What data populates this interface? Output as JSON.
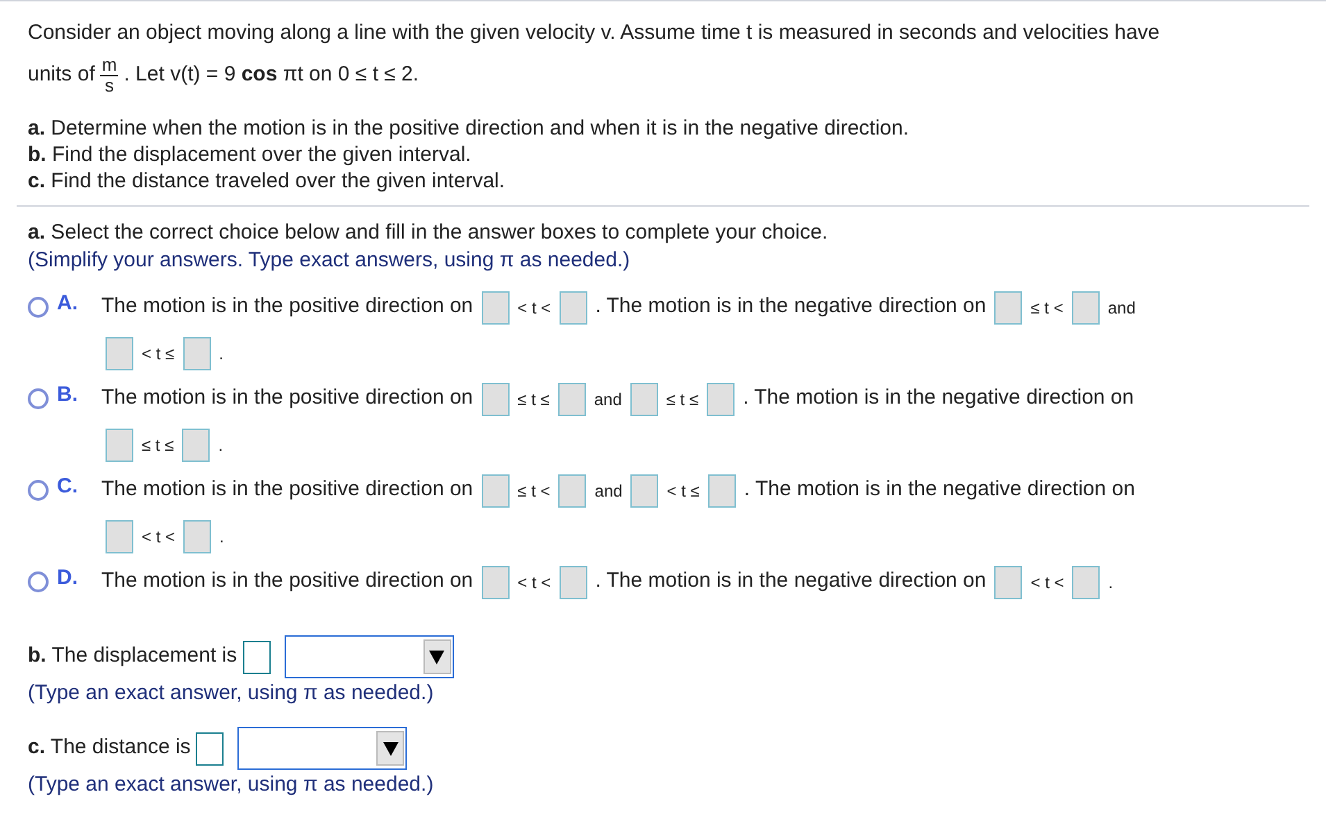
{
  "problem": {
    "line_1": "Consider an object moving along a line with the given velocity v. Assume time t is measured in seconds and velocities have",
    "units_prefix": "units of",
    "fraction": {
      "numerator": "m",
      "denominator": "s"
    },
    "units_suffix": ". Let v(t) = 9 **cos** πt on 0 ≤ t ≤ 2.",
    "tasks": [
      "**a.** Determine when the motion is in the positive direction and when it is in the negative direction.",
      "**b.** Find the displacement over the given interval.",
      "**c.** Find the distance traveled over the given interval."
    ]
  },
  "part_a": {
    "prompt": "**a.** Select the correct choice below and fill in the answer boxes to complete your choice.",
    "hint": "(Simplify your answers. Type exact answers, using π as needed.)",
    "choices": [
      {
        "letter": "A.",
        "selected": false,
        "lines": [
          [
            {
              "kind": "text",
              "text": "The motion is in the positive direction on"
            },
            {
              "kind": "box"
            },
            {
              "kind": "text",
              "text": "< t <"
            },
            {
              "kind": "box"
            },
            {
              "kind": "text",
              "text": ". The motion is in the negative direction on"
            },
            {
              "kind": "box"
            },
            {
              "kind": "text",
              "text": "≤ t <"
            },
            {
              "kind": "box"
            },
            {
              "kind": "text",
              "text": "and"
            }
          ],
          [
            {
              "kind": "box"
            },
            {
              "kind": "text",
              "text": "< t ≤"
            },
            {
              "kind": "box"
            },
            {
              "kind": "text",
              "text": "."
            }
          ]
        ]
      },
      {
        "letter": "B.",
        "selected": false,
        "lines": [
          [
            {
              "kind": "text",
              "text": "The motion is in the positive direction on"
            },
            {
              "kind": "box"
            },
            {
              "kind": "text",
              "text": "≤ t ≤"
            },
            {
              "kind": "box"
            },
            {
              "kind": "text",
              "text": "and"
            },
            {
              "kind": "box"
            },
            {
              "kind": "text",
              "text": "≤ t ≤"
            },
            {
              "kind": "box"
            },
            {
              "kind": "text",
              "text": ". The motion is in the negative direction on"
            }
          ],
          [
            {
              "kind": "box"
            },
            {
              "kind": "text",
              "text": "≤ t ≤"
            },
            {
              "kind": "box"
            },
            {
              "kind": "text",
              "text": "."
            }
          ]
        ]
      },
      {
        "letter": "C.",
        "selected": false,
        "lines": [
          [
            {
              "kind": "text",
              "text": "The motion is in the positive direction on"
            },
            {
              "kind": "box"
            },
            {
              "kind": "text",
              "text": "≤ t <"
            },
            {
              "kind": "box"
            },
            {
              "kind": "text",
              "text": "and"
            },
            {
              "kind": "box"
            },
            {
              "kind": "text",
              "text": "< t ≤"
            },
            {
              "kind": "box"
            },
            {
              "kind": "text",
              "text": ". The motion is in the negative direction on"
            }
          ],
          [
            {
              "kind": "box"
            },
            {
              "kind": "text",
              "text": "< t <"
            },
            {
              "kind": "box"
            },
            {
              "kind": "text",
              "text": "."
            }
          ]
        ]
      },
      {
        "letter": "D.",
        "selected": false,
        "lines": [
          [
            {
              "kind": "text",
              "text": "The motion is in the positive direction on"
            },
            {
              "kind": "box"
            },
            {
              "kind": "text",
              "text": "< t <"
            },
            {
              "kind": "box"
            },
            {
              "kind": "text",
              "text": ". The motion is in the negative direction on"
            },
            {
              "kind": "box"
            },
            {
              "kind": "text",
              "text": "< t <"
            },
            {
              "kind": "box"
            },
            {
              "kind": "text",
              "text": "."
            }
          ]
        ]
      }
    ]
  },
  "answers": [
    {
      "prompt": "**b.** The displacement is",
      "hint": "(Type an exact answer, using π as needed.)"
    },
    {
      "prompt": "**c.** The distance is",
      "hint": "(Type an exact answer, using π as needed.)"
    }
  ]
}
